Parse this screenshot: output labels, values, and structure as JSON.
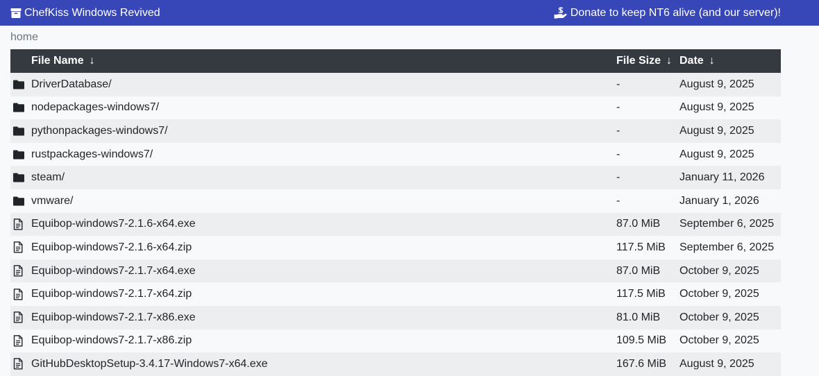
{
  "navbar": {
    "brand": "ChefKiss Windows Revived",
    "donate": "Donate to keep NT6 alive (and our server)!",
    "bg_color": "#3847b8"
  },
  "breadcrumb": "home",
  "table": {
    "headers": {
      "name": "File Name",
      "size": "File Size",
      "date": "Date",
      "sort_arrow": "↓"
    },
    "rows": [
      {
        "type": "folder",
        "name": "DriverDatabase/",
        "size": "-",
        "date": "August 9, 2025"
      },
      {
        "type": "folder",
        "name": "nodepackages-windows7/",
        "size": "-",
        "date": "August 9, 2025"
      },
      {
        "type": "folder",
        "name": "pythonpackages-windows7/",
        "size": "-",
        "date": "August 9, 2025"
      },
      {
        "type": "folder",
        "name": "rustpackages-windows7/",
        "size": "-",
        "date": "August 9, 2025"
      },
      {
        "type": "folder",
        "name": "steam/",
        "size": "-",
        "date": "January 11, 2026"
      },
      {
        "type": "folder",
        "name": "vmware/",
        "size": "-",
        "date": "January 1, 2026"
      },
      {
        "type": "file",
        "name": "Equibop-windows7-2.1.6-x64.exe",
        "size": "87.0 MiB",
        "date": "September 6, 2025"
      },
      {
        "type": "file",
        "name": "Equibop-windows7-2.1.6-x64.zip",
        "size": "117.5 MiB",
        "date": "September 6, 2025"
      },
      {
        "type": "file",
        "name": "Equibop-windows7-2.1.7-x64.exe",
        "size": "87.0 MiB",
        "date": "October 9, 2025"
      },
      {
        "type": "file",
        "name": "Equibop-windows7-2.1.7-x64.zip",
        "size": "117.5 MiB",
        "date": "October 9, 2025"
      },
      {
        "type": "file",
        "name": "Equibop-windows7-2.1.7-x86.exe",
        "size": "81.0 MiB",
        "date": "October 9, 2025"
      },
      {
        "type": "file",
        "name": "Equibop-windows7-2.1.7-x86.zip",
        "size": "109.5 MiB",
        "date": "October 9, 2025"
      },
      {
        "type": "file",
        "name": "GitHubDesktopSetup-3.4.17-Windows7-x64.exe",
        "size": "167.6 MiB",
        "date": "August 9, 2025"
      }
    ]
  }
}
